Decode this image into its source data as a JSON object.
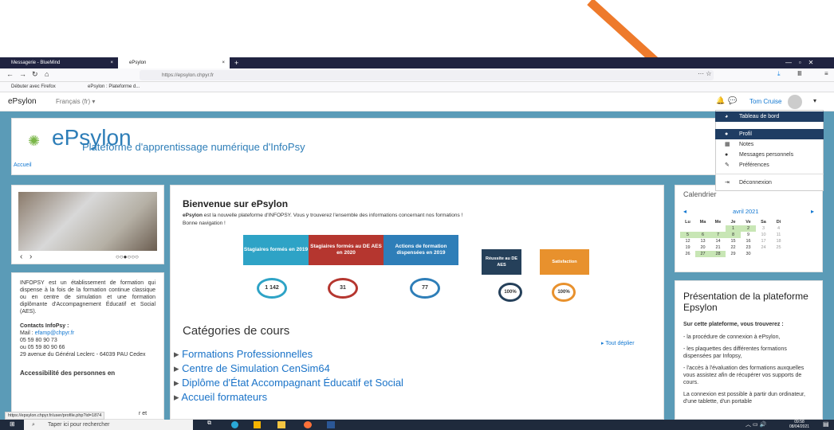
{
  "tabs": [
    {
      "label": "Messagerie - BlueMind",
      "close": "×"
    },
    {
      "label": "ePsylon",
      "close": "×"
    }
  ],
  "new_tab": "+",
  "url": "https://epsylon.chpyr.fr",
  "bookmarks": [
    {
      "label": "Débuter avec Firefox"
    },
    {
      "label": "ePsylon : Plateforme d..."
    }
  ],
  "site": {
    "brand": "ePsylon",
    "lang": "Français (fr)",
    "user": "Tom Cruise"
  },
  "header": {
    "logo": "ePsylon",
    "tagline": "Plateforme d'apprentissage numérique d'InfoPsy",
    "breadcrumb": "Accueil"
  },
  "left": {
    "carousel_dots": "○○●○○○",
    "about": "INFOPSY est un établissement de formation qui dispense à la fois de la formation continue classique ou en centre de simulation et une formation diplômante d'Accompagnement Éducatif et Social (AES).",
    "contacts_title": "Contacts InfoPsy :",
    "mail_label": "Mail : ",
    "mail": "efamp@chpyr.fr",
    "phone1": "05 59 80 90 73",
    "phone2": "ou 05 59 80 90 66",
    "address": "29 avenue du Général Leclerc - 64039 PAU Cedex",
    "access": "Accessibilité des personnes en"
  },
  "main": {
    "welcome_title": "Bienvenue sur ePsylon",
    "welcome_bold": "ePsylon",
    "welcome_text": " est la nouvelle plateforme d'INFOPSY. Vous y trouverez l'ensemble des informations concernant nos formations !",
    "welcome_text2": "Bonne navigation !",
    "stats": [
      {
        "label": "Stagiaires formés en 2019",
        "value": "1 142",
        "color": "#2ea3c6"
      },
      {
        "label": "Stagiaires formés au DE AES en 2020",
        "value": "31",
        "color": "#b5362f"
      },
      {
        "label": "Actions de formation dispensées en 2019",
        "value": "77",
        "color": "#2e7eb8"
      },
      {
        "label": "Réussite au DE AES",
        "value": "100%",
        "color": "#25405a"
      },
      {
        "label": "Satisfaction",
        "value": "100%",
        "color": "#e8912d"
      }
    ],
    "categories_title": "Catégories de cours",
    "expand_all": "Tout déplier",
    "categories": [
      "Formations Professionnelles",
      "Centre de Simulation CenSim64",
      "Diplôme d'État Accompagnant Éducatif et Social",
      "Accueil formateurs"
    ]
  },
  "calendar": {
    "title": "Calendrier",
    "month": "avril 2021",
    "days": [
      "Lu",
      "Ma",
      "Me",
      "Je",
      "Ve",
      "Sa",
      "Di"
    ],
    "weeks": [
      [
        "",
        "",
        "",
        "1",
        "2",
        "3",
        "4"
      ],
      [
        "5",
        "6",
        "7",
        "8",
        "9",
        "10",
        "11"
      ],
      [
        "12",
        "13",
        "14",
        "15",
        "16",
        "17",
        "18"
      ],
      [
        "19",
        "20",
        "21",
        "22",
        "23",
        "24",
        "25"
      ],
      [
        "26",
        "27",
        "28",
        "29",
        "30",
        "",
        ""
      ]
    ]
  },
  "presentation": {
    "title": "Présentation de la plateforme Epsylon",
    "subtitle": "Sur cette plateforme, vous trouverez :",
    "items": [
      "- la procédure de connexion à ePsylon,",
      "- les plaquettes des différentes formations dispensées par Infopsy,",
      "- l'accès à l'évaluation des formations auxquelles vous assistez afin de récupérer vos supports de cours.",
      "La connexion est possible à partir dun ordinateur, d'une tablette, d'un portable"
    ]
  },
  "user_menu": {
    "items": [
      "Tableau de bord",
      "Profil",
      "Notes",
      "Messages personnels",
      "Préférences",
      "Déconnexion"
    ]
  },
  "status_url": "https://epsylon.chpyr.fr/user/profile.php?id=1874",
  "status_tail": "r et",
  "taskbar": {
    "search": "Taper ici pour rechercher",
    "time": "09:58",
    "date": "08/04/2021"
  },
  "colors": {
    "arrow": "#ee7a2b",
    "accent": "#1f6b9a"
  }
}
